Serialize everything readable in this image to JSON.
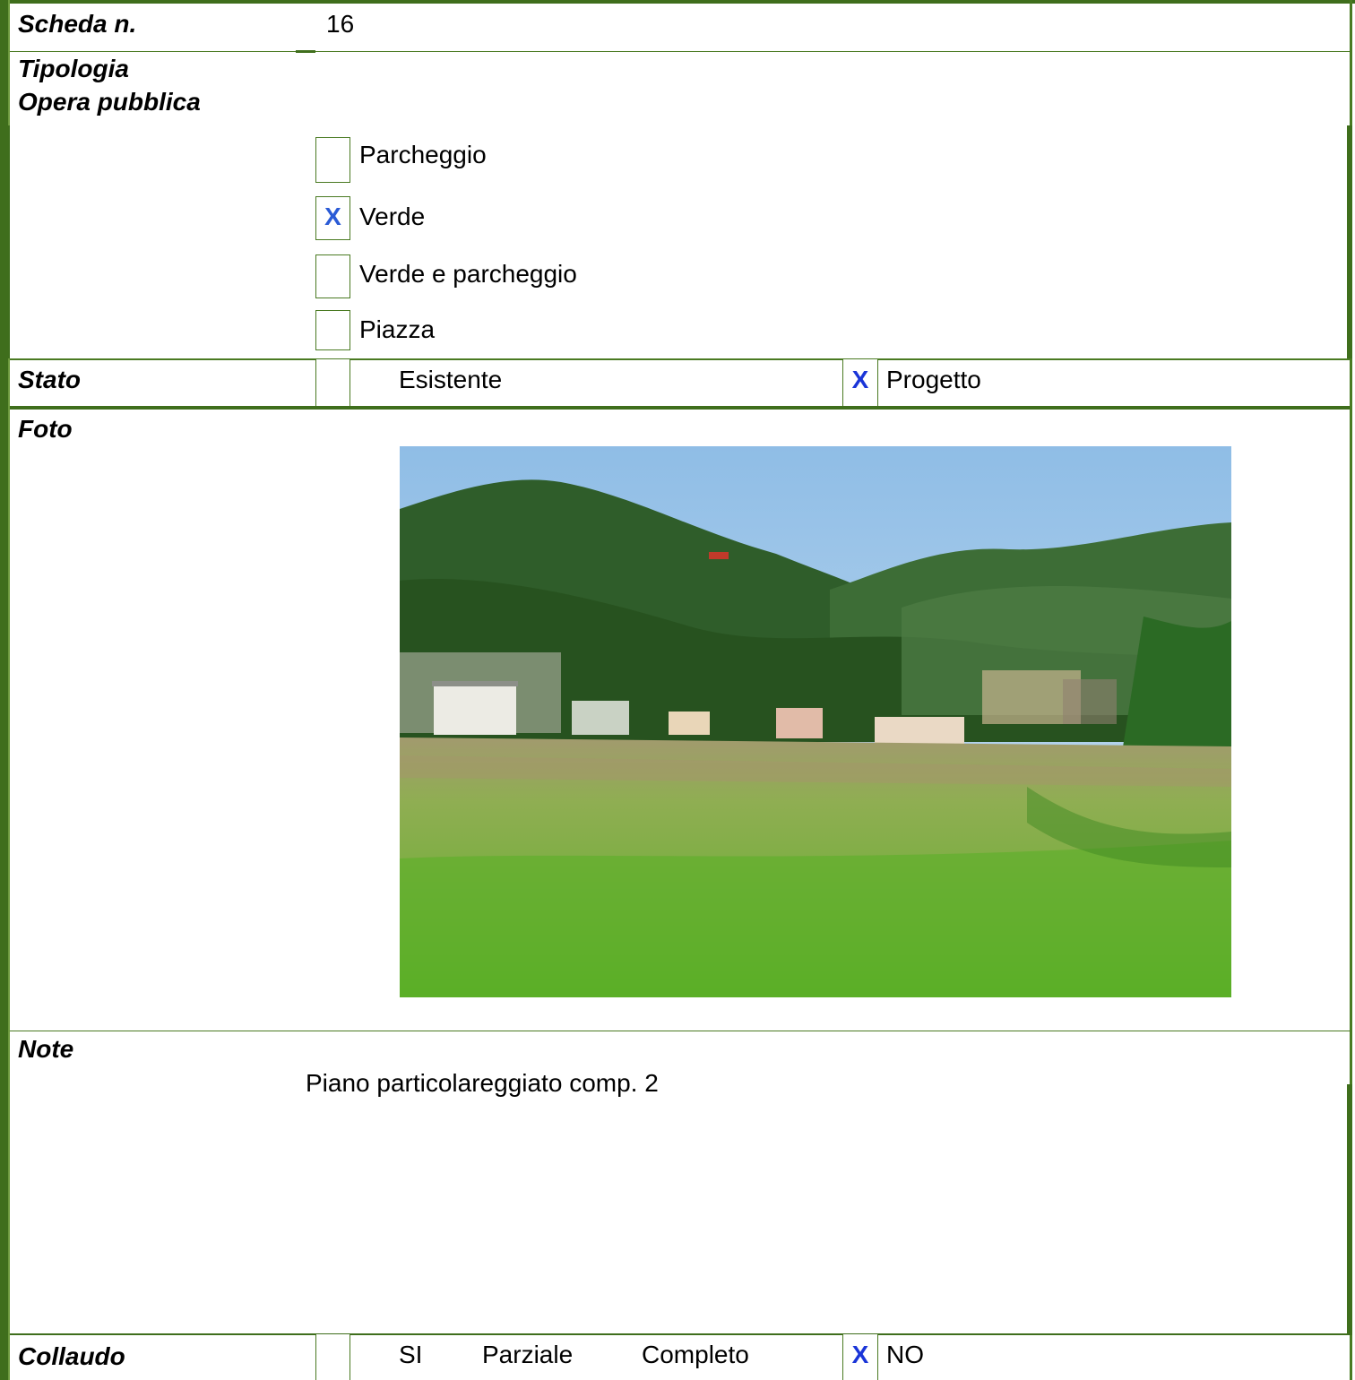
{
  "scheda": {
    "label": "Scheda n.",
    "value": "16"
  },
  "tipologia": {
    "label_line1": "Tipologia",
    "label_line2": "Opera pubblica",
    "options": [
      {
        "label": "Parcheggio",
        "mark": ""
      },
      {
        "label": "Verde",
        "mark": "X"
      },
      {
        "label": "Verde e parcheggio",
        "mark": ""
      },
      {
        "label": "Piazza",
        "mark": ""
      }
    ]
  },
  "stato": {
    "label": "Stato",
    "esistente_mark": "",
    "esistente": "Esistente",
    "progetto_mark": "X",
    "progetto": "Progetto"
  },
  "foto": {
    "label": "Foto"
  },
  "note": {
    "label": "Note",
    "text": "Piano particolareggiato comp. 2"
  },
  "collaudo": {
    "label": "Collaudo",
    "si_mark": "",
    "si": "SI",
    "parziale": "Parziale",
    "completo": "Completo",
    "no_mark": "X",
    "no": "NO"
  },
  "colors": {
    "border_green": "#3f6e1c",
    "mark_blue": "#2b5bd6"
  }
}
